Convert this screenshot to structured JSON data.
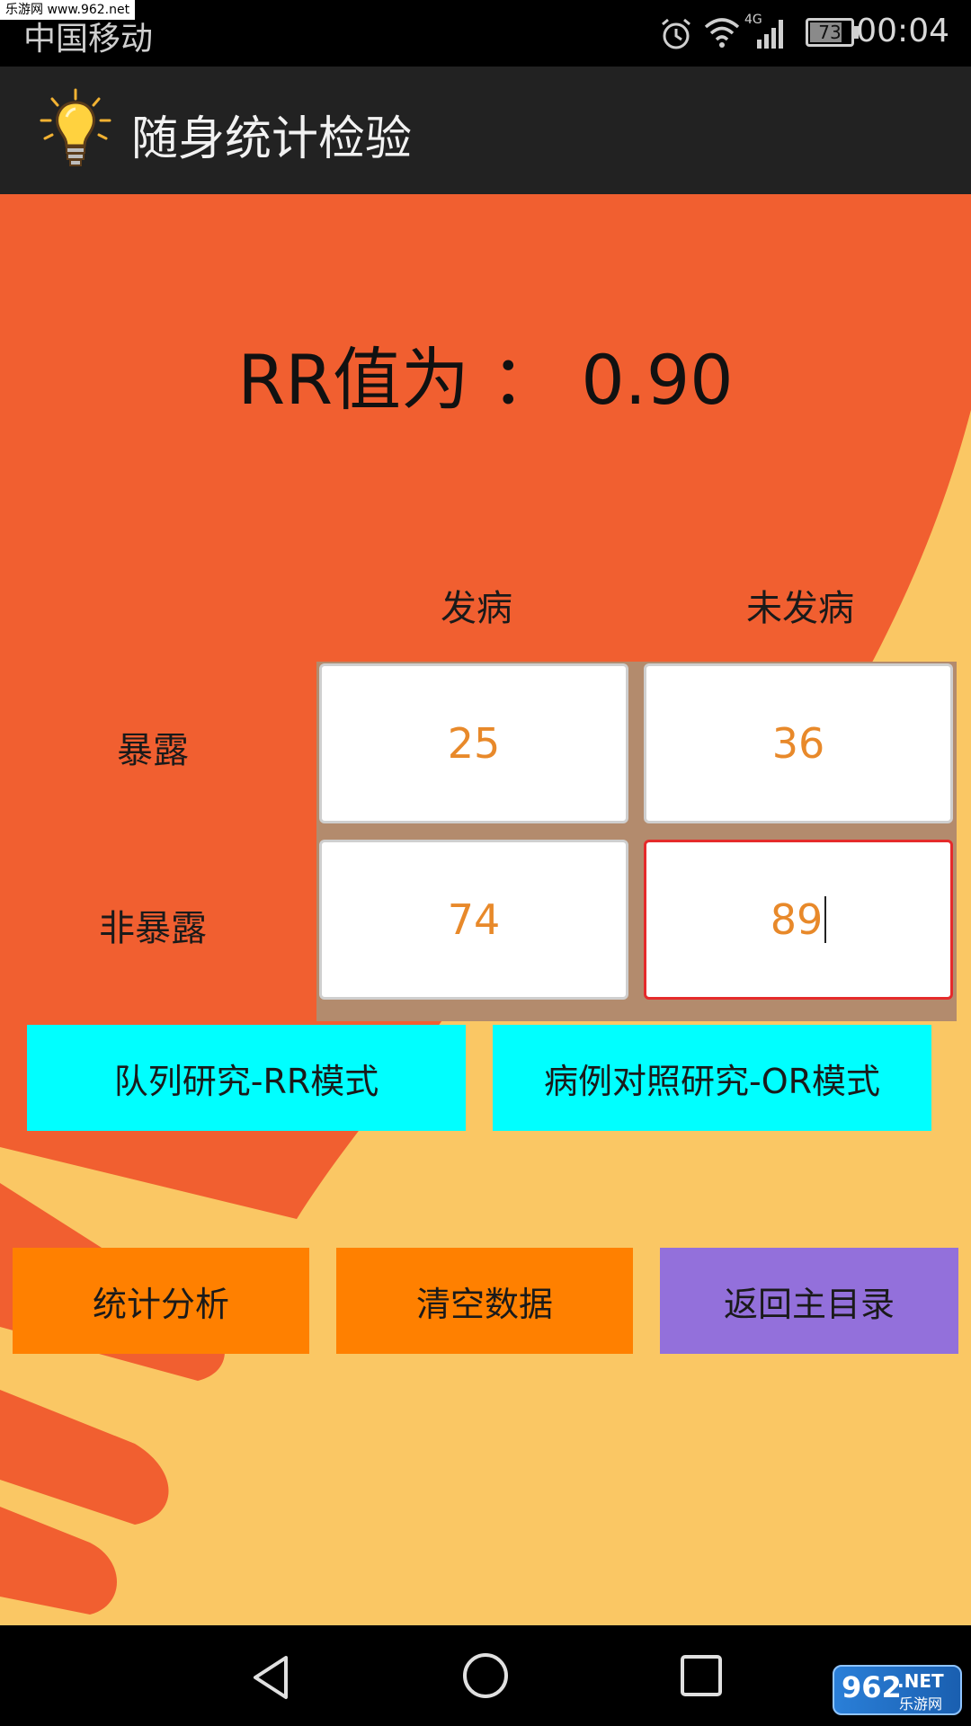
{
  "status_bar": {
    "watermark": "乐游网 www.962.net",
    "carrier": "中国移动",
    "network_type": "4G",
    "battery": "73",
    "time": "00:04",
    "icons": [
      "alarm-icon",
      "wifi-icon",
      "signal-icon",
      "battery-icon"
    ]
  },
  "app_bar": {
    "title": "随身统计检验",
    "icon": "lightbulb-icon"
  },
  "result": {
    "label": "RR值为",
    "separator": "：",
    "value": "0.90"
  },
  "table": {
    "col_headers": [
      "发病",
      "未发病"
    ],
    "row_labels": [
      "暴露",
      "非暴露"
    ],
    "cells": [
      [
        "25",
        "36"
      ],
      [
        "74",
        "89"
      ]
    ],
    "focused_cell": [
      1,
      1
    ]
  },
  "mode_buttons": {
    "cohort": "队列研究-RR模式",
    "case_control": "病例对照研究-OR模式"
  },
  "action_buttons": {
    "analyze": "统计分析",
    "clear": "清空数据",
    "home": "返回主目录"
  },
  "nav_bar": {
    "icons": [
      "back-icon",
      "home-icon",
      "recents-icon"
    ]
  },
  "watermark_logo": {
    "brand": "962",
    "tld": ".NET",
    "caption": "乐游网"
  },
  "colors": {
    "accent_orange": "#f15f30",
    "background_yellow": "#fac764",
    "mode_button": "#00ffff",
    "action_button": "#ff8000",
    "home_button": "#9370db",
    "cell_text": "#e8892a",
    "focus_border": "#e52b2b"
  }
}
